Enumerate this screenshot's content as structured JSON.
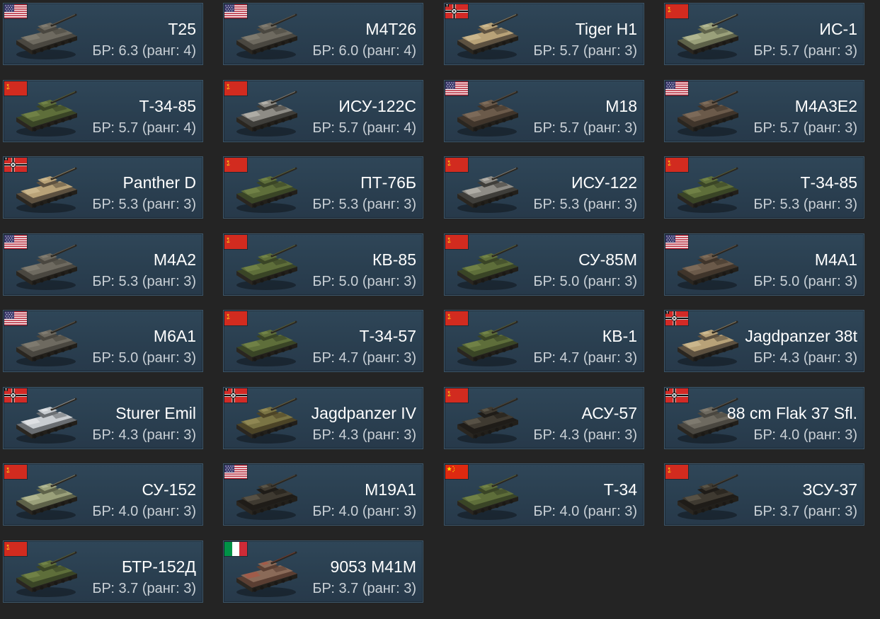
{
  "cards": [
    {
      "name": "T25",
      "br": "БР: 6.3 (ранг: 4)",
      "nation": "usa",
      "camo": "grey"
    },
    {
      "name": "M4T26",
      "br": "БР: 6.0 (ранг: 4)",
      "nation": "usa",
      "camo": "grey"
    },
    {
      "name": "Tiger H1",
      "br": "БР: 5.7 (ранг: 3)",
      "nation": "germany",
      "camo": "desert"
    },
    {
      "name": "ИС-1",
      "br": "БР: 5.7 (ранг: 3)",
      "nation": "ussr",
      "camo": "light"
    },
    {
      "name": "Т-34-85",
      "br": "БР: 5.7 (ранг: 4)",
      "nation": "ussr",
      "camo": "green"
    },
    {
      "name": "ИСУ-122С",
      "br": "БР: 5.7 (ранг: 4)",
      "nation": "ussr",
      "camo": "winter"
    },
    {
      "name": "M18",
      "br": "БР: 5.7 (ранг: 3)",
      "nation": "usa",
      "camo": "brown"
    },
    {
      "name": "M4A3E2",
      "br": "БР: 5.7 (ранг: 3)",
      "nation": "usa",
      "camo": "brown"
    },
    {
      "name": "Panther D",
      "br": "БР: 5.3 (ранг: 3)",
      "nation": "germany",
      "camo": "desert"
    },
    {
      "name": "ПТ-76Б",
      "br": "БР: 5.3 (ранг: 3)",
      "nation": "ussr",
      "camo": "green"
    },
    {
      "name": "ИСУ-122",
      "br": "БР: 5.3 (ранг: 3)",
      "nation": "ussr",
      "camo": "winter"
    },
    {
      "name": "Т-34-85",
      "br": "БР: 5.3 (ранг: 3)",
      "nation": "ussr",
      "camo": "green"
    },
    {
      "name": "M4A2",
      "br": "БР: 5.3 (ранг: 3)",
      "nation": "usa",
      "camo": "grey"
    },
    {
      "name": "КВ-85",
      "br": "БР: 5.0 (ранг: 3)",
      "nation": "ussr",
      "camo": "green"
    },
    {
      "name": "СУ-85М",
      "br": "БР: 5.0 (ранг: 3)",
      "nation": "ussr",
      "camo": "green"
    },
    {
      "name": "M4A1",
      "br": "БР: 5.0 (ранг: 3)",
      "nation": "usa",
      "camo": "brown"
    },
    {
      "name": "M6A1",
      "br": "БР: 5.0 (ранг: 3)",
      "nation": "usa",
      "camo": "grey"
    },
    {
      "name": "Т-34-57",
      "br": "БР: 4.7 (ранг: 3)",
      "nation": "ussr",
      "camo": "green"
    },
    {
      "name": "КВ-1",
      "br": "БР: 4.7 (ранг: 3)",
      "nation": "ussr",
      "camo": "green"
    },
    {
      "name": "Jagdpanzer 38t",
      "br": "БР: 4.3 (ранг: 3)",
      "nation": "germany",
      "camo": "desert"
    },
    {
      "name": "Sturer Emil",
      "br": "БР: 4.3 (ранг: 3)",
      "nation": "germany",
      "camo": "white"
    },
    {
      "name": "Jagdpanzer IV",
      "br": "БР: 4.3 (ранг: 3)",
      "nation": "germany",
      "camo": "olive"
    },
    {
      "name": "АСУ-57",
      "br": "БР: 4.3 (ранг: 3)",
      "nation": "ussr",
      "camo": "dark"
    },
    {
      "name": "88 cm Flak 37 Sfl.",
      "br": "БР: 4.0 (ранг: 3)",
      "nation": "germany",
      "camo": "grey"
    },
    {
      "name": "СУ-152",
      "br": "БР: 4.0 (ранг: 3)",
      "nation": "ussr",
      "camo": "light"
    },
    {
      "name": "M19A1",
      "br": "БР: 4.0 (ранг: 3)",
      "nation": "usa",
      "camo": "dark"
    },
    {
      "name": "Т-34",
      "br": "БР: 4.0 (ранг: 3)",
      "nation": "china",
      "camo": "green"
    },
    {
      "name": "ЗСУ-37",
      "br": "БР: 3.7 (ранг: 3)",
      "nation": "ussr",
      "camo": "dark"
    },
    {
      "name": "БТР-152Д",
      "br": "БР: 3.7 (ранг: 3)",
      "nation": "ussr",
      "camo": "green"
    },
    {
      "name": "9053 M41M",
      "br": "БР: 3.7 (ранг: 3)",
      "nation": "italy",
      "camo": "red"
    }
  ],
  "colors": {
    "background": "#242424",
    "card": "#2c4254",
    "card_border": "#3d5669",
    "name_text": "#ffffff",
    "br_text": "#c9d0d6"
  }
}
